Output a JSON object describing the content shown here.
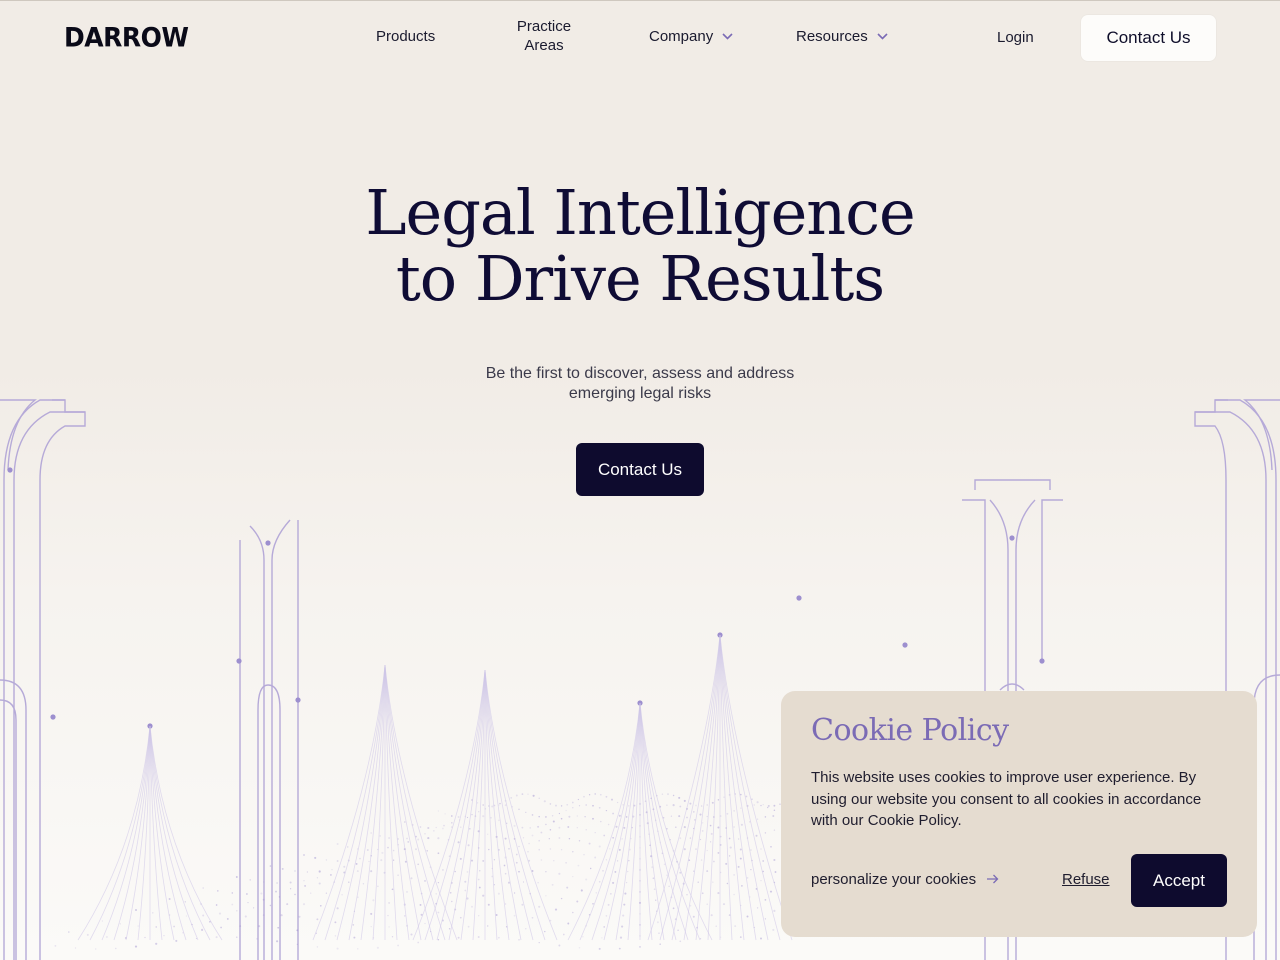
{
  "brand": {
    "logo_text": "DARROW"
  },
  "nav": {
    "products": "Products",
    "practice_areas_line1": "Practice",
    "practice_areas_line2": "Areas",
    "company": "Company",
    "resources": "Resources",
    "login": "Login",
    "contact": "Contact Us"
  },
  "hero": {
    "title_line1": "Legal Intelligence",
    "title_line2": "to Drive Results",
    "subtitle_line1": "Be the first to discover, assess and address",
    "subtitle_line2": "emerging legal risks",
    "cta": "Contact Us"
  },
  "cookie": {
    "title": "Cookie Policy",
    "text": "This website uses cookies to improve user experience.  By using our website you consent to all cookies in accordance with our Cookie Policy.",
    "personalize": "personalize your cookies",
    "refuse": "Refuse",
    "accept": "Accept"
  },
  "colors": {
    "background": "#f1ece6",
    "primary_dark": "#0e0b2e",
    "accent_purple": "#7b6bb5",
    "cookie_bg": "#e5dcd0",
    "decor_line": "#a99bd0"
  },
  "icons": {
    "chevron": "chevron-down-icon",
    "arrow": "arrow-right-icon"
  }
}
